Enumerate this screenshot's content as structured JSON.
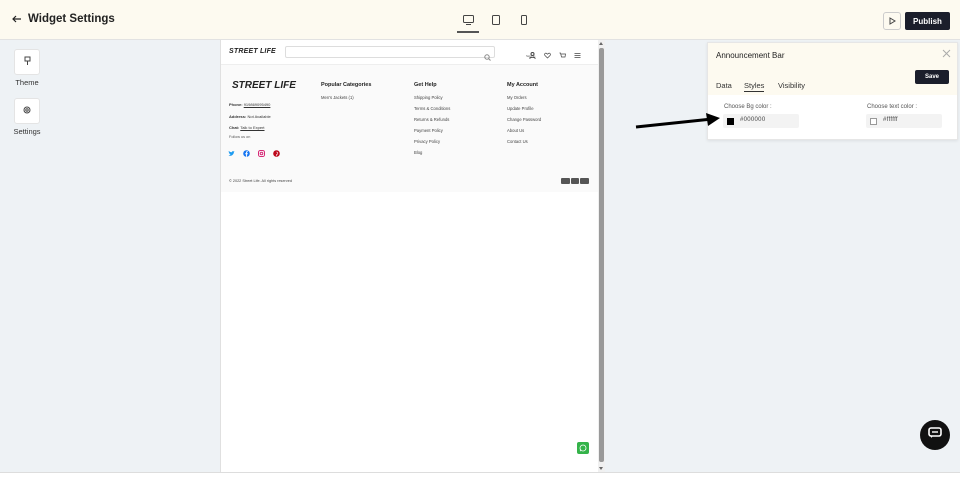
{
  "topbar": {
    "title": "Widget Settings",
    "publish_label": "Publish",
    "devices": [
      "desktop-icon",
      "tablet-icon",
      "mobile-icon"
    ],
    "active_device": "desktop"
  },
  "sidebar": {
    "items": [
      {
        "label": "Theme",
        "icon": "brush-icon"
      },
      {
        "label": "Settings",
        "icon": "gear-icon"
      }
    ]
  },
  "preview": {
    "header": {
      "logo": "STREET LIFE",
      "signin_label": "Sign In"
    },
    "footer": {
      "logo": "STREET LIFE",
      "phone_label": "Phone:",
      "phone_value": "919869095490",
      "address_label": "Address:",
      "address_value": "Not Available",
      "chat_label": "Chat:",
      "chat_value": "Talk to Expert",
      "follow_label": "Follow us on",
      "columns": [
        {
          "title": "Popular Categories",
          "links": [
            "Men's Jackets (1)"
          ]
        },
        {
          "title": "Get Help",
          "links": [
            "Shipping Policy",
            "Terms & Conditions",
            "Returns & Refunds",
            "Payment Policy",
            "Privacy Policy",
            "Blog"
          ]
        },
        {
          "title": "My Account",
          "links": [
            "My Orders",
            "Update Profile",
            "Change Password",
            "About Us",
            "Contact Us"
          ]
        }
      ],
      "copyright": "© 2022 Street Life. All rights reserved"
    }
  },
  "panel": {
    "title": "Announcement Bar",
    "save_label": "Save",
    "tabs": [
      "Data",
      "Styles",
      "Visibility"
    ],
    "active_tab": "Styles",
    "bg_color_label": "Choose Bg color :",
    "bg_color_value": "#000000",
    "text_color_label": "Choose text color :",
    "text_color_value": "#ffffff"
  },
  "colors": {
    "dark_button": "#1b1e2b",
    "topbar_bg": "#fdfaf0",
    "whatsapp": "#34b34a"
  }
}
